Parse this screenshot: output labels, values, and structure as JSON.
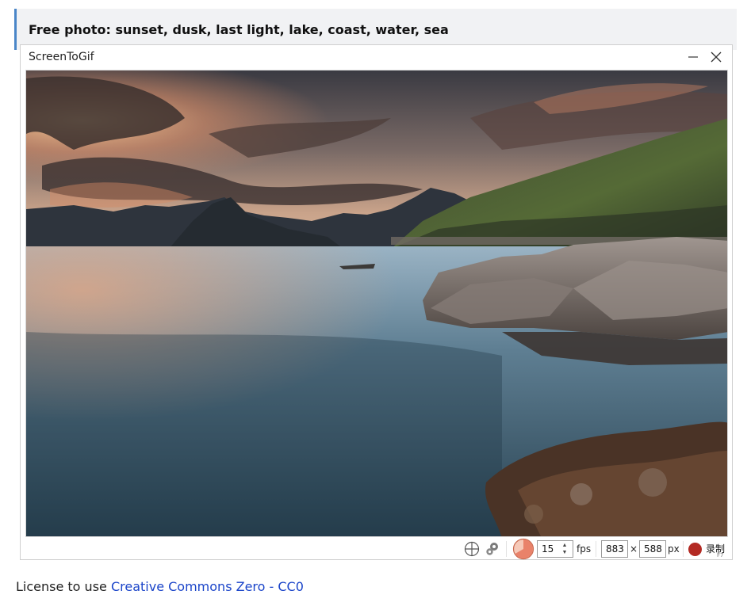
{
  "page_title": "Free photo: sunset, dusk, last light, lake, coast, water, sea",
  "window": {
    "title": "ScreenToGif",
    "minimize_icon": "minimize-icon",
    "close_icon": "close-icon"
  },
  "toolbar": {
    "snap_icon": "crosshair-icon",
    "options_icon": "gear-icon",
    "framerate_icon": "pie-timer-icon",
    "fps_value": "15",
    "fps_label": "fps",
    "width_value": "883",
    "times_symbol": "×",
    "height_value": "588",
    "unit_label": "px",
    "record_label": "录制",
    "record_hotkey": "F7"
  },
  "license": {
    "prefix": "License to use ",
    "link_text": "Creative Commons Zero - CC0"
  },
  "colors": {
    "accent_bar": "#4a86c8",
    "record": "#b32a23",
    "link": "#1a44c9",
    "framerate_icon": "#e9826a"
  }
}
